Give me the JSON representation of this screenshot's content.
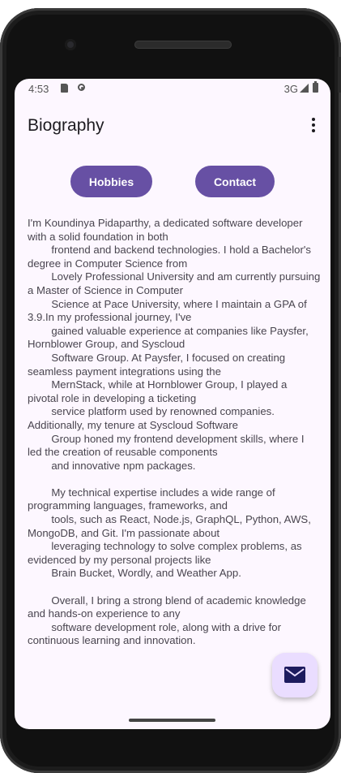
{
  "status": {
    "time": "4:53",
    "network": "3G",
    "icons": [
      "sd-card-icon",
      "notification-dot-icon",
      "signal-icon",
      "battery-icon"
    ]
  },
  "appbar": {
    "title": "Biography",
    "menu_icon": "more-vert-icon"
  },
  "buttons": {
    "hobbies": "Hobbies",
    "contact": "Contact"
  },
  "bio": {
    "text": "I'm Koundinya Pidaparthy, a dedicated software developer with a solid foundation in both\n        frontend and backend technologies. I hold a Bachelor's degree in Computer Science from\n        Lovely Professional University and am currently pursuing a Master of Science in Computer\n        Science at Pace University, where I maintain a GPA of 3.9.In my professional journey, I've\n        gained valuable experience at companies like Paysfer, Hornblower Group, and Syscloud\n        Software Group. At Paysfer, I focused on creating seamless payment integrations using the\n        MernStack, while at Hornblower Group, I played a pivotal role in developing a ticketing\n        service platform used by renowned companies. Additionally, my tenure at Syscloud Software\n        Group honed my frontend development skills, where I led the creation of reusable components\n        and innovative npm packages.\n\n        My technical expertise includes a wide range of programming languages, frameworks, and\n        tools, such as React, Node.js, GraphQL, Python, AWS, MongoDB, and Git. I'm passionate about\n        leveraging technology to solve complex problems, as evidenced by my personal projects like\n        Brain Bucket, Wordly, and Weather App.\n\n        Overall, I bring a strong blend of academic knowledge and hands-on experience to any\n        software development role, along with a drive for continuous learning and innovation."
  },
  "fab": {
    "icon": "email-icon"
  },
  "colors": {
    "primary": "#6750a4",
    "fab_container": "#eaddff",
    "background": "#fdf7ff",
    "body_text": "#49454f"
  }
}
